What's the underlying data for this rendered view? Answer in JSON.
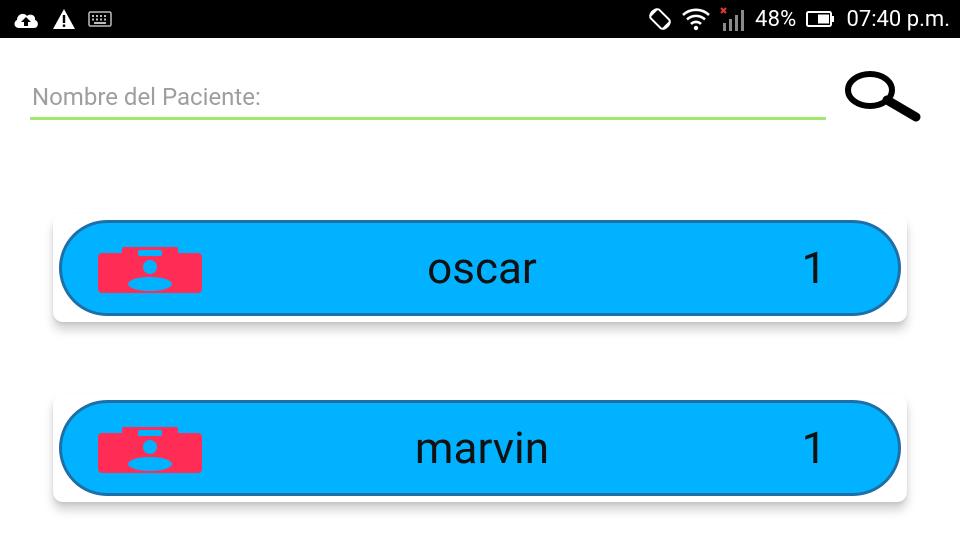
{
  "status_bar": {
    "battery": "48%",
    "time": "07:40 p.m.",
    "icons": [
      "cloud-upload-icon",
      "warning-icon",
      "keyboard-icon",
      "rotation-lock-icon",
      "wifi-icon",
      "signal-no-service-icon",
      "battery-icon"
    ]
  },
  "search": {
    "placeholder": "Nombre del Paciente:",
    "value": "",
    "icon": "search-icon"
  },
  "patients": [
    {
      "name": "oscar",
      "count": "1",
      "icon": "id-badge-icon"
    },
    {
      "name": "marvin",
      "count": "1",
      "icon": "id-badge-icon"
    }
  ],
  "colors": {
    "status_bar": "#000000",
    "search_underline": "#a2e86a",
    "pill_fill": "#00b2ff",
    "pill_border": "#1e6fa8",
    "badge": "#ff2d55"
  }
}
